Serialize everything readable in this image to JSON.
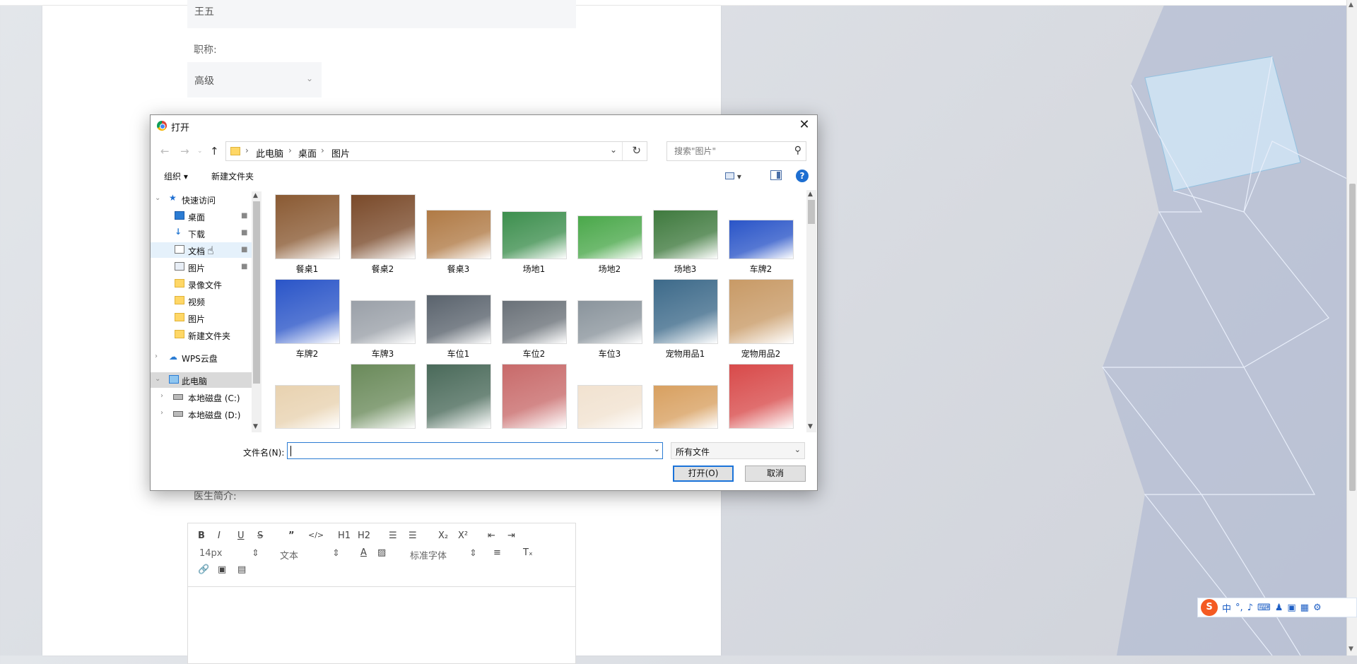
{
  "form": {
    "name_value": "王五",
    "title_label": "职称:",
    "title_value": "高级",
    "intro_label": "医生简介:"
  },
  "editor": {
    "bold": "B",
    "italic": "I",
    "underline": "U",
    "strike": "S",
    "quote": "”",
    "code": "</>",
    "h1": "H1",
    "h2": "H2",
    "ol": "☰",
    "ul": "☰",
    "sub": "X₂",
    "sup": "X²",
    "indent_out": "⇤",
    "indent_in": "⇥",
    "font_size": "14px",
    "text_style": "文本",
    "font_family": "标准字体",
    "align": "≡",
    "clear": "Tₓ"
  },
  "dialog": {
    "title": "打开",
    "close": "✕",
    "address": {
      "crumbs": [
        "此电脑",
        "桌面",
        "图片"
      ]
    },
    "search_placeholder": "搜索\"图片\"",
    "commands": {
      "organize": "组织 ▾",
      "new_folder": "新建文件夹"
    },
    "nav": {
      "quick_access": "快速访问",
      "items": [
        {
          "label": "桌面",
          "pinned": true
        },
        {
          "label": "下载",
          "pinned": true
        },
        {
          "label": "文档",
          "pinned": true
        },
        {
          "label": "图片",
          "pinned": true
        },
        {
          "label": "录像文件"
        },
        {
          "label": "视频"
        },
        {
          "label": "图片"
        },
        {
          "label": "新建文件夹"
        }
      ],
      "wps": "WPS云盘",
      "this_pc": "此电脑",
      "drives": [
        "本地磁盘 (C:)",
        "本地磁盘 (D:)"
      ]
    },
    "files": [
      {
        "label": "餐桌1",
        "color": "#8a5a33"
      },
      {
        "label": "餐桌2",
        "color": "#7a4a2a"
      },
      {
        "label": "餐桌3",
        "color": "#b07a45"
      },
      {
        "label": "场地1",
        "color": "#3d8f4e"
      },
      {
        "label": "场地2",
        "color": "#4aa84a"
      },
      {
        "label": "场地3",
        "color": "#3f7a3e"
      },
      {
        "label": "车牌2",
        "color": "#2a55c8"
      },
      {
        "label": "车牌2",
        "color": "#2a55c8"
      },
      {
        "label": "车牌3",
        "color": "#9aa0a8"
      },
      {
        "label": "车位1",
        "color": "#5a636d"
      },
      {
        "label": "车位2",
        "color": "#6a7178"
      },
      {
        "label": "车位3",
        "color": "#8a949c"
      },
      {
        "label": "宠物用品1",
        "color": "#3d6a8a"
      },
      {
        "label": "宠物用品2",
        "color": "#c89a66"
      },
      {
        "label": "",
        "color": "#e8d2b0"
      },
      {
        "label": "",
        "color": "#6a8a5a"
      },
      {
        "label": "",
        "color": "#4a6a5a"
      },
      {
        "label": "",
        "color": "#c86a6a"
      },
      {
        "label": "",
        "color": "#f1e2d0"
      },
      {
        "label": "",
        "color": "#d8a060"
      },
      {
        "label": "",
        "color": "#d84a4a"
      }
    ],
    "filename_label": "文件名(N):",
    "filename_value": "",
    "filetype": "所有文件",
    "open_btn": "打开(O)",
    "cancel_btn": "取消"
  },
  "ime": {
    "logo": "S",
    "mode": "中",
    "punct": "°,",
    "mic": "♪",
    "kb": "⌨",
    "shirt": "♟",
    "game": "▣",
    "grid": "▦",
    "gear": "⚙"
  }
}
